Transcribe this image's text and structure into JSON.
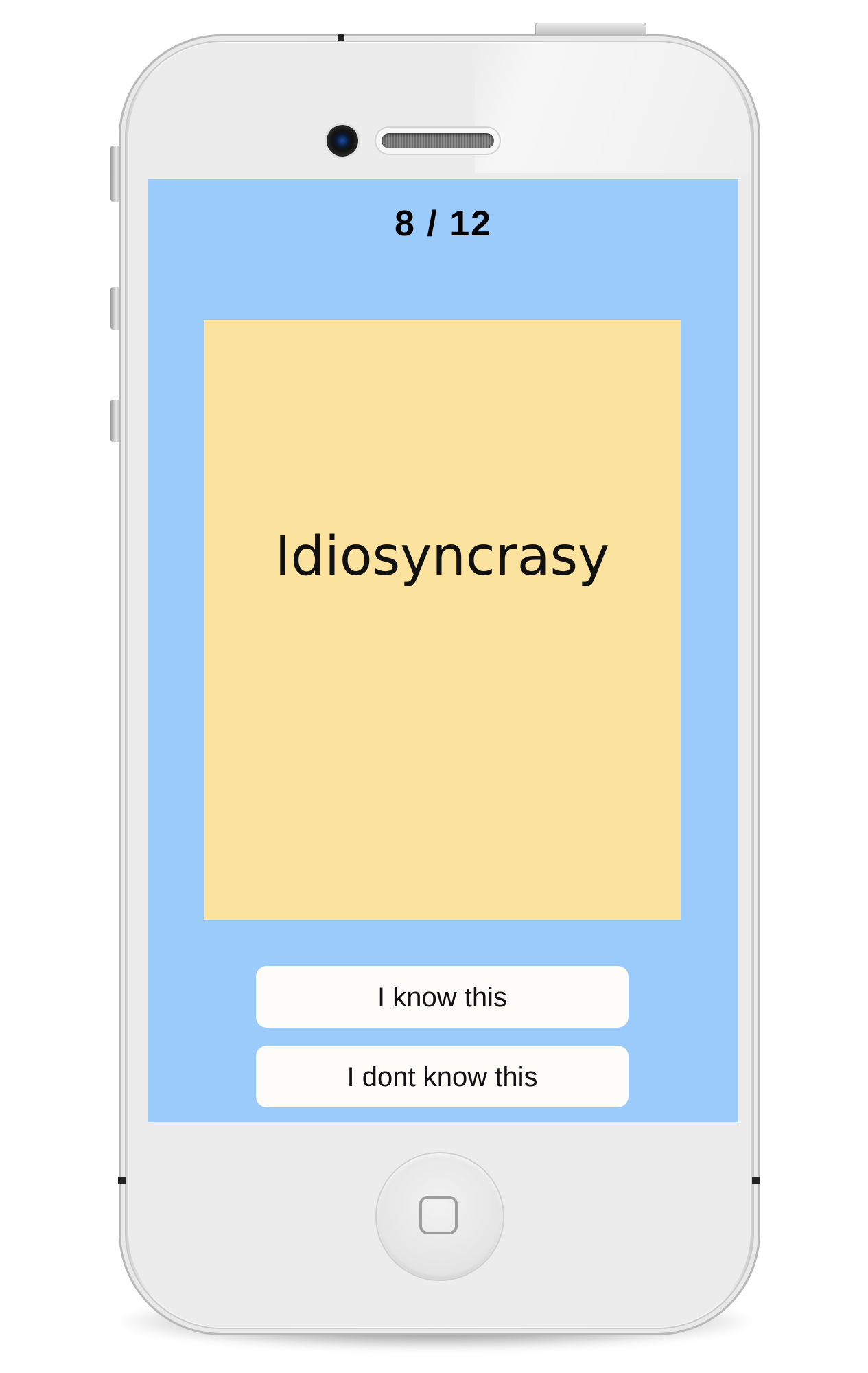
{
  "app": {
    "progress": {
      "current": 8,
      "total": 12,
      "label": "8  /  12"
    },
    "card": {
      "word": "Idiosyncrasy"
    },
    "buttons": {
      "know_label": "I know this",
      "dont_know_label": "I dont know this"
    }
  },
  "colors": {
    "screen_background": "#9bcbfb",
    "card_background": "#fbe29e",
    "button_background": "#fdfcf8",
    "text": "#111111"
  },
  "icons": {
    "home": "home-button-square-icon",
    "camera": "front-camera-icon",
    "speaker": "earpiece-speaker-icon"
  }
}
